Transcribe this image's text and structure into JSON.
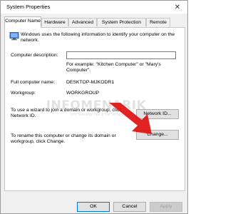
{
  "window": {
    "title": "System Properties",
    "close_glyph": "✕"
  },
  "tabs": [
    {
      "label": "Computer Name",
      "active": true
    },
    {
      "label": "Hardware",
      "active": false
    },
    {
      "label": "Advanced",
      "active": false
    },
    {
      "label": "System Protection",
      "active": false
    },
    {
      "label": "Remote",
      "active": false
    }
  ],
  "panel": {
    "description": "Windows uses the following information to identify your computer on the network.",
    "computer_description_label": "Computer description:",
    "computer_description_value": "",
    "example_text": "For example: \"Kitchen Computer\" or \"Mary's Computer\".",
    "full_name_label": "Full computer name:",
    "full_name_value": "DESKTOP-MJKODR1",
    "workgroup_label": "Workgroup:",
    "workgroup_value": "WORKGROUP",
    "network_id_text": "To use a wizard to join a domain or workgroup, click Network ID.",
    "network_id_button": "Network ID...",
    "change_text": "To rename this computer or change its domain or workgroup, click Change.",
    "change_button": "Change..."
  },
  "watermark": {
    "text": "INFOMENARIK",
    "subtext": "Info Teknologi Tips & Trik Terbaru"
  },
  "footer": {
    "ok": "OK",
    "cancel": "Cancel",
    "apply": "Apply"
  },
  "colors": {
    "accent": "#0078d7",
    "arrow": "#e01010"
  },
  "icons": {
    "computer": "computer-icon",
    "close": "close-icon"
  }
}
